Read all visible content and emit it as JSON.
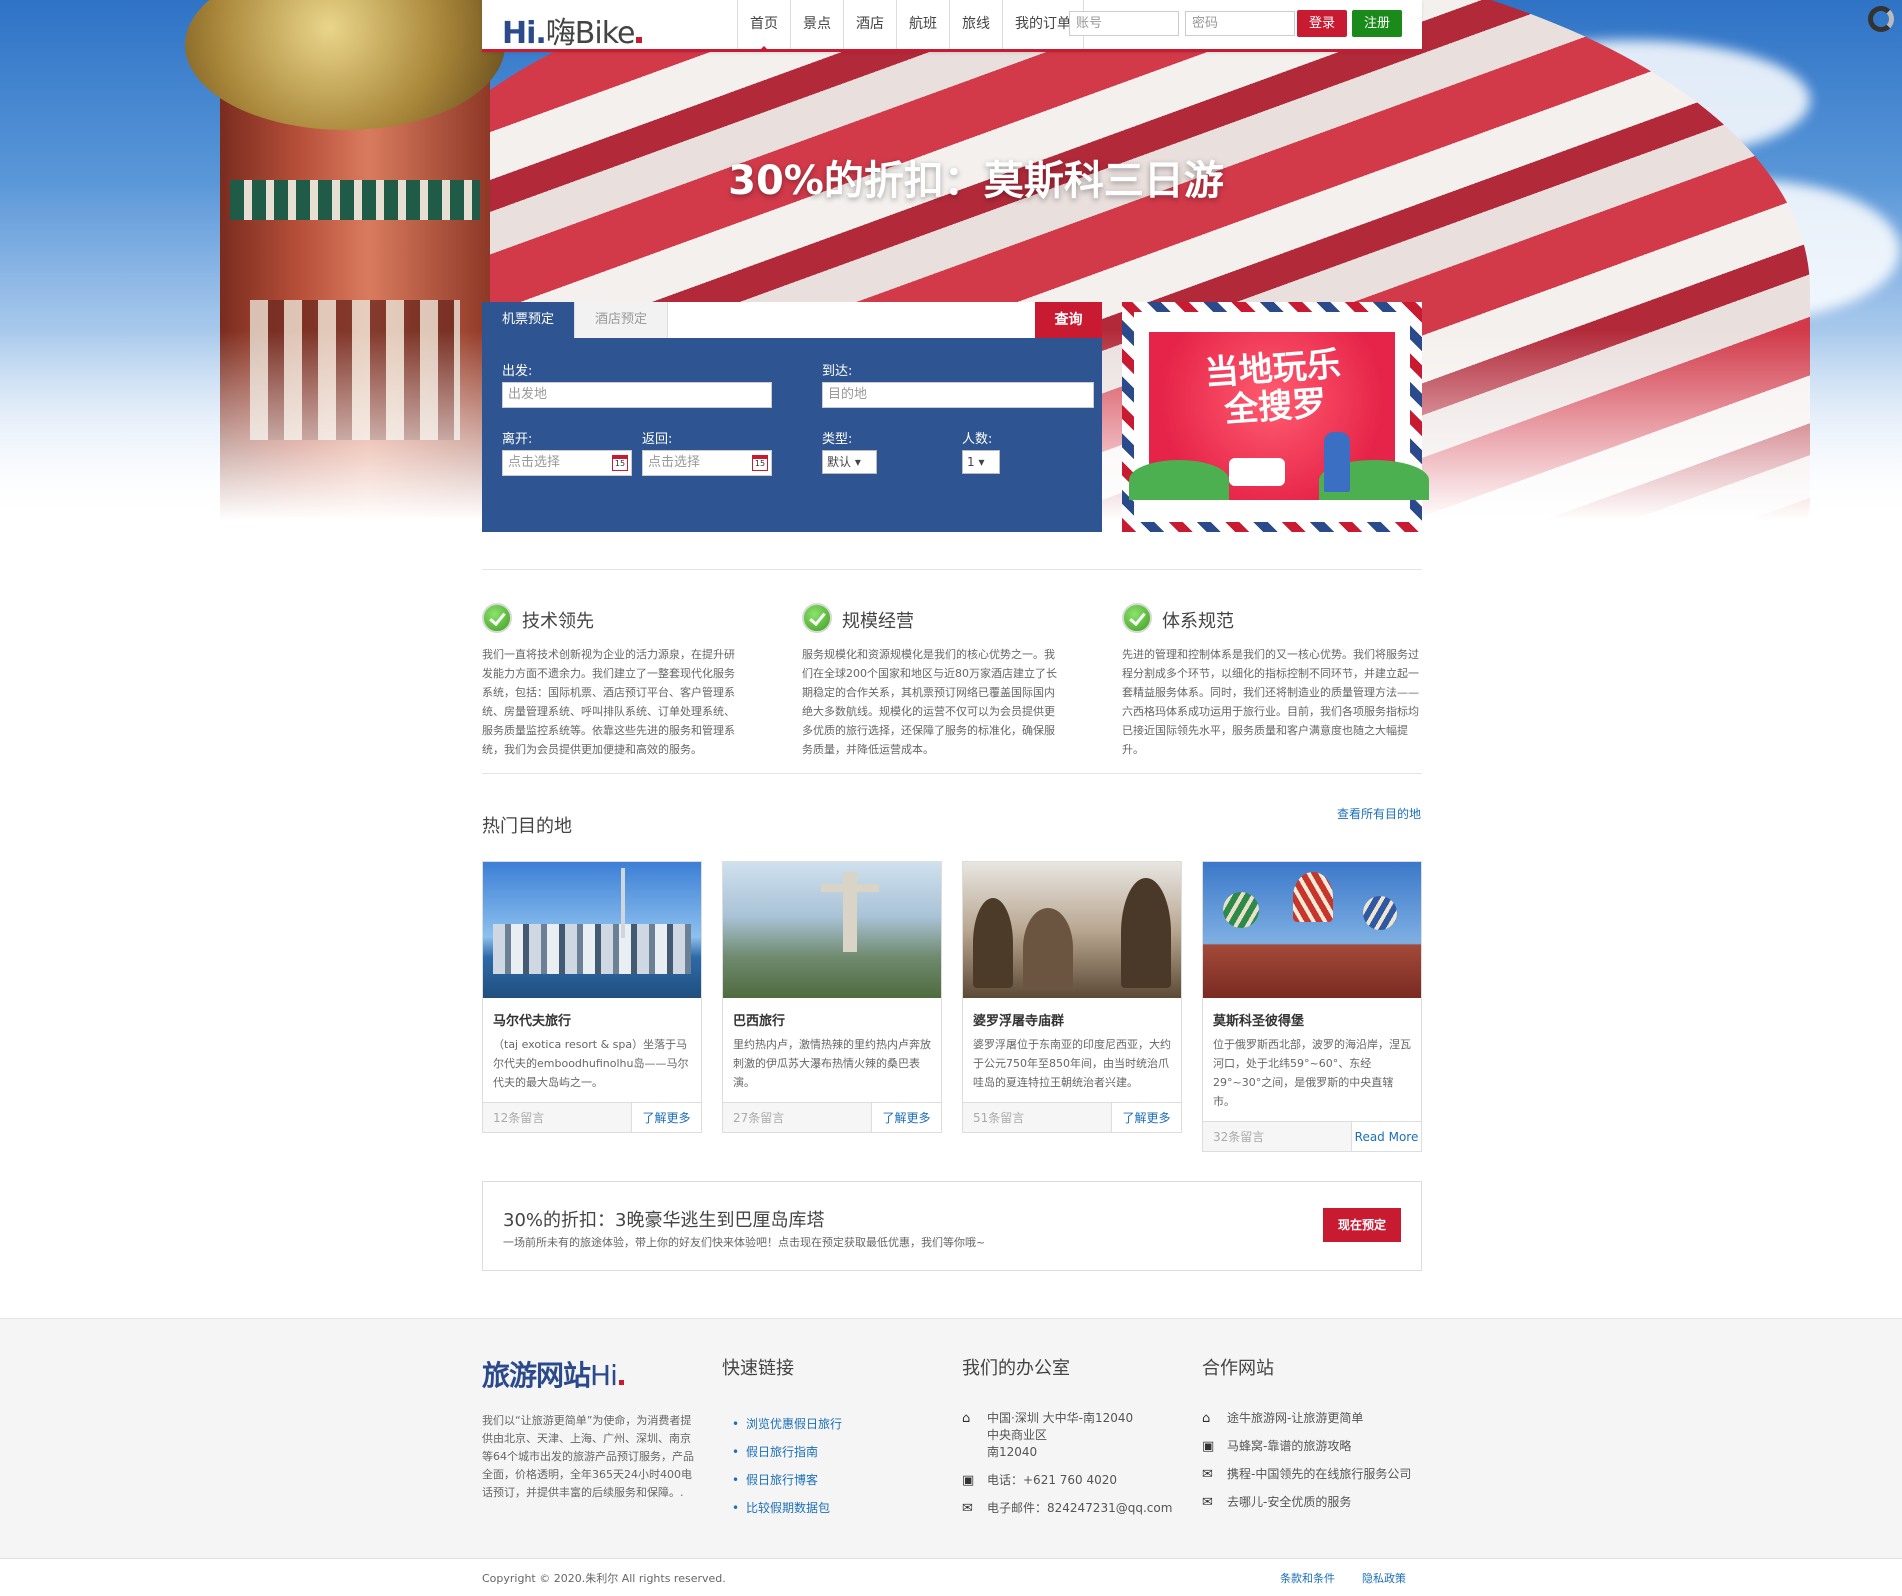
{
  "nav": {
    "logo_hi": "Hi.",
    "logo_rest": "嗨Bike",
    "menu": [
      "首页",
      "景点",
      "酒店",
      "航班",
      "旅线",
      "我的订单"
    ],
    "account_placeholder": "账号",
    "password_placeholder": "密码",
    "login": "登录",
    "register": "注册"
  },
  "hero": {
    "title": "30%的折扣：莫斯科三日游"
  },
  "search": {
    "tabs": [
      "机票预定",
      "酒店预定"
    ],
    "query": "查询",
    "from_label": "出发:",
    "from_placeholder": "出发地",
    "to_label": "到达:",
    "to_placeholder": "目的地",
    "depart_label": "离开:",
    "depart_placeholder": "点击选择",
    "return_label": "返回:",
    "return_placeholder": "点击选择",
    "type_label": "类型:",
    "type_value": "默认",
    "people_label": "人数:",
    "people_value": "1",
    "cal_num": "15"
  },
  "promo_stamp": {
    "text1": "当地玩乐",
    "text2": "全搜罗"
  },
  "features": [
    {
      "title": "技术领先",
      "text": "我们一直将技术创新视为企业的活力源泉，在提升研发能力方面不遗余力。我们建立了一整套现代化服务系统，包括：国际机票、酒店预订平台、客户管理系统、房量管理系统、呼叫排队系统、订单处理系统、服务质量监控系统等。依靠这些先进的服务和管理系统，我们为会员提供更加便捷和高效的服务。"
    },
    {
      "title": "规模经营",
      "text": "服务规模化和资源规模化是我们的核心优势之一。我们在全球200个国家和地区与近80万家酒店建立了长期稳定的合作关系，其机票预订网络已覆盖国际国内绝大多数航线。规模化的运营不仅可以为会员提供更多优质的旅行选择，还保障了服务的标准化，确保服务质量，并降低运营成本。"
    },
    {
      "title": "体系规范",
      "text": "先进的管理和控制体系是我们的又一核心优势。我们将服务过程分割成多个环节，以细化的指标控制不同环节，并建立起一套精益服务体系。同时，我们还将制造业的质量管理方法——六西格玛体系成功运用于旅行业。目前，我们各项服务指标均已接近国际领先水平，服务质量和客户满意度也随之大幅提升。"
    }
  ],
  "destinations": {
    "title": "热门目的地",
    "see_all": "查看所有目的地",
    "cards": [
      {
        "name": "马尔代夫旅行",
        "desc": "（taj exotica resort & spa）坐落于马尔代夫的emboodhufinolhu岛——马尔代夫的最大岛屿之一。",
        "comments": "12条留言",
        "more": "了解更多"
      },
      {
        "name": "巴西旅行",
        "desc": "里约热内卢，激情热辣的里约热内卢奔放刺激的伊瓜苏大瀑布热情火辣的桑巴表演。",
        "comments": "27条留言",
        "more": "了解更多"
      },
      {
        "name": "婆罗浮屠寺庙群",
        "desc": "婆罗浮屠位于东南亚的印度尼西亚，大约于公元750年至850年间，由当时统治爪哇岛的夏连特拉王朝统治者兴建。",
        "comments": "51条留言",
        "more": "了解更多"
      },
      {
        "name": "莫斯科圣彼得堡",
        "desc": "位于俄罗斯西北部，波罗的海沿岸，涅瓦河口，处于北纬59°~60°、东经29°~30°之间，是俄罗斯的中央直辖市。",
        "comments": "32条留言",
        "more": "Read More"
      }
    ]
  },
  "banner": {
    "title": "30%的折扣：3晚豪华逃生到巴厘岛库塔",
    "desc": "一场前所未有的旅途体验，带上你的好友们快来体验吧！点击现在预定获取最低优惠，我们等你哦~",
    "button": "现在预定"
  },
  "footer": {
    "logo_main": "旅游网站",
    "logo_hi": "Hi",
    "about": "我们以“让旅游更简单”为使命，为消费者提供由北京、天津、上海、广州、深圳、南京等64个城市出发的旅游产品预订服务，产品全面，价格透明，全年365天24小时400电话预订，并提供丰富的后续服务和保障。.",
    "quick_title": "快速链接",
    "quick_links": [
      "浏览优惠假日旅行",
      "假日旅行指南",
      "假日旅行博客",
      "比较假期数据包"
    ],
    "office_title": "我们的办公室",
    "address": [
      "中国·深圳 大中华-南12040",
      "中央商业区",
      "南12040"
    ],
    "phone": "电话：+621 760 4020",
    "email": "电子邮件：824247231@qq.com",
    "partner_title": "合作网站",
    "partners": [
      "途牛旅游网-让旅游更简单",
      "马蜂窝-靠谱的旅游攻略",
      "携程-中国领先的在线旅行服务公司",
      "去哪儿-安全优质的服务"
    ]
  },
  "bottom": {
    "copyright": "Copyright © 2020.朱利尔 All rights reserved.",
    "terms": "条款和条件",
    "privacy": "隐私政策"
  }
}
